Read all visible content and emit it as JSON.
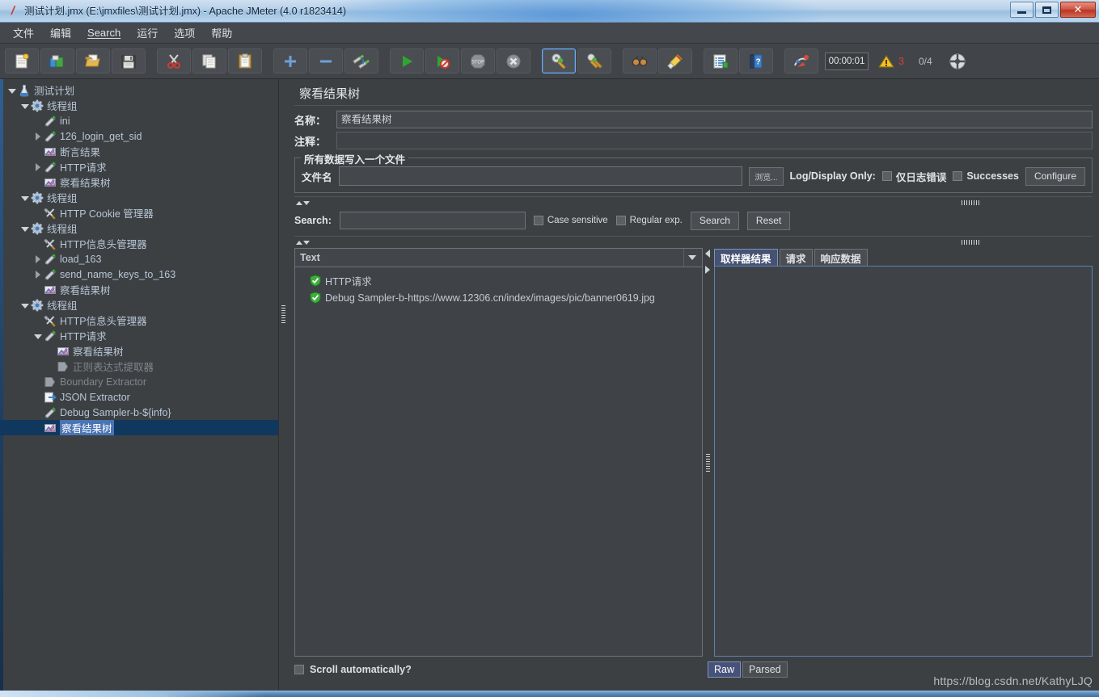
{
  "window": {
    "title": "测试计划.jmx (E:\\jmxfiles\\测试计划.jmx) - Apache JMeter (4.0 r1823414)",
    "minimize_label": "",
    "maximize_label": "",
    "close_label": "✕"
  },
  "menu": {
    "items": [
      {
        "label": "文件",
        "name": "menu-file"
      },
      {
        "label": "编辑",
        "name": "menu-edit"
      },
      {
        "label": "Search",
        "name": "menu-search"
      },
      {
        "label": "运行",
        "name": "menu-run"
      },
      {
        "label": "选项",
        "name": "menu-options"
      },
      {
        "label": "帮助",
        "name": "menu-help"
      }
    ]
  },
  "toolbar": {
    "timer": "00:00:01",
    "warn_count": "3",
    "thread_ratio": "0/4",
    "buttons": [
      {
        "name": "new-icon",
        "title": "New"
      },
      {
        "name": "templates-icon",
        "title": "Templates"
      },
      {
        "name": "open-icon",
        "title": "Open"
      },
      {
        "name": "save-icon",
        "title": "Save"
      },
      {
        "name": "cut-icon",
        "title": "Cut"
      },
      {
        "name": "copy-icon",
        "title": "Copy"
      },
      {
        "name": "paste-icon",
        "title": "Paste"
      },
      {
        "name": "expand-all-icon",
        "title": "Expand all"
      },
      {
        "name": "collapse-all-icon",
        "title": "Collapse all"
      },
      {
        "name": "toggle-icon",
        "title": "Toggle"
      },
      {
        "name": "start-icon",
        "title": "Start"
      },
      {
        "name": "start-no-pause-icon",
        "title": "Start no timers"
      },
      {
        "name": "stop-icon",
        "title": "Stop"
      },
      {
        "name": "shutdown-icon",
        "title": "Shutdown"
      },
      {
        "name": "clear-icon",
        "title": "Clear"
      },
      {
        "name": "clear-all-icon",
        "title": "Clear all"
      },
      {
        "name": "search-icon",
        "title": "Search"
      },
      {
        "name": "reset-search-icon",
        "title": "Reset Search"
      },
      {
        "name": "function-helper-icon",
        "title": "Function Helper"
      },
      {
        "name": "help-icon",
        "title": "Help"
      },
      {
        "name": "undo-redo-icon",
        "title": "Undo"
      }
    ]
  },
  "tree": {
    "nodes": [
      {
        "label": "测试计划",
        "depth": 0,
        "toggle": "down",
        "icon": "test-plan-icon",
        "selected": false,
        "dim": false
      },
      {
        "label": "线程组",
        "depth": 1,
        "toggle": "down",
        "icon": "thread-group-icon",
        "selected": false,
        "dim": false
      },
      {
        "label": "ini",
        "depth": 2,
        "toggle": "none",
        "icon": "sampler-icon",
        "selected": false,
        "dim": false
      },
      {
        "label": "126_login_get_sid",
        "depth": 2,
        "toggle": "right",
        "icon": "sampler-icon",
        "selected": false,
        "dim": false
      },
      {
        "label": "断言结果",
        "depth": 2,
        "toggle": "none",
        "icon": "listener-icon",
        "selected": false,
        "dim": false
      },
      {
        "label": "HTTP请求",
        "depth": 2,
        "toggle": "right",
        "icon": "sampler-icon",
        "selected": false,
        "dim": false
      },
      {
        "label": "察看结果树",
        "depth": 2,
        "toggle": "none",
        "icon": "listener-icon",
        "selected": false,
        "dim": false
      },
      {
        "label": "线程组",
        "depth": 1,
        "toggle": "down",
        "icon": "thread-group-icon",
        "selected": false,
        "dim": false
      },
      {
        "label": "HTTP Cookie 管理器",
        "depth": 2,
        "toggle": "none",
        "icon": "config-icon",
        "selected": false,
        "dim": false
      },
      {
        "label": "线程组",
        "depth": 1,
        "toggle": "down",
        "icon": "thread-group-icon",
        "selected": false,
        "dim": false
      },
      {
        "label": "HTTP信息头管理器",
        "depth": 2,
        "toggle": "none",
        "icon": "config-icon",
        "selected": false,
        "dim": false
      },
      {
        "label": "load_163",
        "depth": 2,
        "toggle": "right",
        "icon": "sampler-icon",
        "selected": false,
        "dim": false
      },
      {
        "label": "send_name_keys_to_163",
        "depth": 2,
        "toggle": "right",
        "icon": "sampler-icon",
        "selected": false,
        "dim": false
      },
      {
        "label": "察看结果树",
        "depth": 2,
        "toggle": "none",
        "icon": "listener-icon",
        "selected": false,
        "dim": false
      },
      {
        "label": "线程组",
        "depth": 1,
        "toggle": "down",
        "icon": "thread-group-icon",
        "selected": false,
        "dim": false
      },
      {
        "label": "HTTP信息头管理器",
        "depth": 2,
        "toggle": "none",
        "icon": "config-icon",
        "selected": false,
        "dim": false
      },
      {
        "label": "HTTP请求",
        "depth": 2,
        "toggle": "down",
        "icon": "sampler-icon",
        "selected": false,
        "dim": false
      },
      {
        "label": "察看结果树",
        "depth": 3,
        "toggle": "none",
        "icon": "listener-icon",
        "selected": false,
        "dim": false
      },
      {
        "label": "正则表达式提取器",
        "depth": 3,
        "toggle": "none",
        "icon": "post-processor-icon",
        "selected": false,
        "dim": true
      },
      {
        "label": "Boundary Extractor",
        "depth": 2,
        "toggle": "none",
        "icon": "post-processor-icon",
        "selected": false,
        "dim": true
      },
      {
        "label": "JSON Extractor",
        "depth": 2,
        "toggle": "none",
        "icon": "json-extractor-icon",
        "selected": false,
        "dim": false
      },
      {
        "label": "Debug Sampler-b-${info}",
        "depth": 2,
        "toggle": "none",
        "icon": "sampler-icon",
        "selected": false,
        "dim": false
      },
      {
        "label": "察看结果树",
        "depth": 2,
        "toggle": "none",
        "icon": "listener-icon",
        "selected": true,
        "dim": false
      }
    ]
  },
  "panel": {
    "title": "察看结果树",
    "name_label": "名称：",
    "name_value": "察看结果树",
    "comment_label": "注释：",
    "comment_value": "",
    "file_group": {
      "legend": "所有数据写入一个文件",
      "filename_label": "文件名",
      "filename_value": "",
      "browse_label": "浏览...",
      "log_display_label": "Log/Display Only:",
      "errors_only_label": "仅日志错误",
      "errors_only_checked": false,
      "successes_label": "Successes",
      "successes_checked": false,
      "configure_label": "Configure"
    },
    "search": {
      "label": "Search:",
      "value": "",
      "case_sensitive_label": "Case sensitive",
      "case_sensitive_checked": false,
      "regex_label": "Regular exp.",
      "regex_checked": false,
      "search_button": "Search",
      "reset_button": "Reset"
    },
    "render_combo": "Text",
    "sample_results": [
      {
        "label": "HTTP请求",
        "status": "success"
      },
      {
        "label": "Debug Sampler-b-https://www.12306.cn/index/images/pic/banner0619.jpg",
        "status": "success"
      }
    ],
    "tabs": [
      {
        "label": "取样器结果",
        "active": true,
        "name": "tab-sampler-result"
      },
      {
        "label": "请求",
        "active": false,
        "name": "tab-request"
      },
      {
        "label": "响应数据",
        "active": false,
        "name": "tab-response-data"
      }
    ],
    "scroll_auto_label": "Scroll automatically?",
    "scroll_auto_checked": false,
    "view_modes": [
      {
        "label": "Raw",
        "active": true,
        "name": "view-mode-raw"
      },
      {
        "label": "Parsed",
        "active": false,
        "name": "view-mode-parsed"
      }
    ]
  },
  "watermark": "https://blog.csdn.net/KathyLJQ",
  "colors": {
    "accent_blue": "#4a74b3",
    "panel_bg": "#3c4043",
    "tree_text": "#b9c6d6",
    "warn_red": "#e03b2e",
    "tab_active": "#465273"
  }
}
